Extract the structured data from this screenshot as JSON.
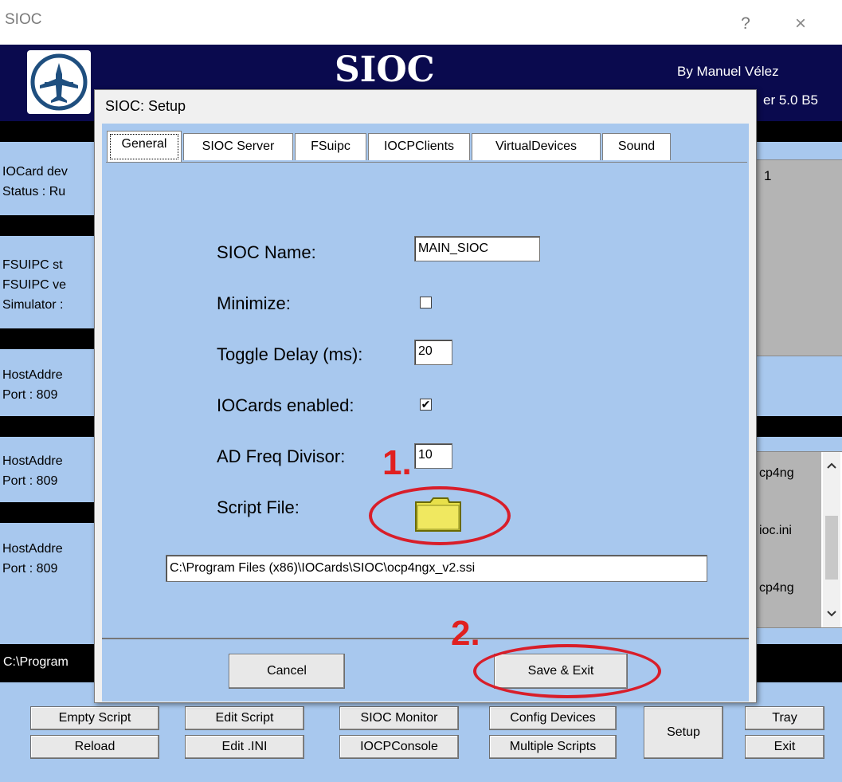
{
  "window": {
    "title": "SIOC",
    "help": "?",
    "close": "×"
  },
  "header": {
    "title": "SIOC",
    "author": "By Manuel Vélez",
    "version": "er 5.0 B5"
  },
  "background_info": {
    "iocard": [
      "IOCard dev",
      "Status : Ru"
    ],
    "fsuipc": [
      "FSUIPC st",
      "FSUIPC ve",
      "Simulator :"
    ],
    "host1": [
      "HostAddre",
      "Port :  809"
    ],
    "host2": [
      "HostAddre",
      "Port :  809"
    ],
    "host3": [
      "HostAddre",
      "Port :  809"
    ],
    "right_number": "1",
    "list_items": [
      "cp4ng",
      "ioc.ini",
      "cp4ng"
    ],
    "path": "C:\\Program"
  },
  "bottom_buttons": {
    "empty_script": "Empty Script",
    "reload": "Reload",
    "edit_script": "Edit Script",
    "edit_ini": "Edit .INI",
    "sioc_monitor": "SIOC Monitor",
    "iocp_console": "IOCPConsole",
    "config_devices": "Config Devices",
    "multiple_scripts": "Multiple Scripts",
    "setup": "Setup",
    "tray": "Tray",
    "exit": "Exit"
  },
  "dialog": {
    "title": "SIOC: Setup",
    "tabs": [
      "General",
      "SIOC Server",
      "FSuipc",
      "IOCPClients",
      "VirtualDevices",
      "Sound"
    ],
    "active_tab": "General",
    "general": {
      "sioc_name_label": "SIOC Name:",
      "sioc_name_value": "MAIN_SIOC",
      "minimize_label": "Minimize:",
      "minimize_checked": false,
      "toggle_delay_label": "Toggle Delay (ms):",
      "toggle_delay_value": "20",
      "iocards_label": "IOCards enabled:",
      "iocards_checked": true,
      "ad_freq_label": "AD Freq Divisor:",
      "ad_freq_value": "10",
      "script_file_label": "Script File:",
      "script_path": "C:\\Program Files (x86)\\IOCards\\SIOC\\ocp4ngx_v2.ssi"
    },
    "cancel": "Cancel",
    "save_exit": "Save & Exit"
  },
  "annotations": {
    "step1": "1.",
    "step2": "2."
  },
  "colors": {
    "app_bg": "#a8c8ee",
    "header_bg": "#0a0a4e",
    "annotation": "#d81e2a",
    "folder": "#e8e04a"
  },
  "icons": {
    "logo": "airplane-logo-icon",
    "folder": "folder-icon",
    "scroll_up": "chevron-up-icon",
    "scroll_down": "chevron-down-icon"
  }
}
